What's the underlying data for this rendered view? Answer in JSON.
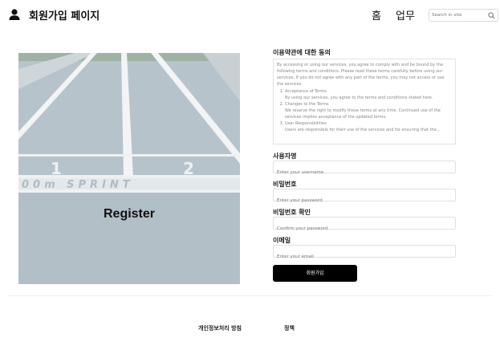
{
  "header": {
    "site_title": "회원가입 페이지",
    "nav": [
      {
        "label": "홈"
      },
      {
        "label": "업무"
      }
    ],
    "search": {
      "placeholder": "Search in site",
      "value": ""
    }
  },
  "hero": {
    "label": "Register",
    "track_text": "00m SPRINT",
    "lane_numbers": [
      "1",
      "2"
    ]
  },
  "form": {
    "terms": {
      "label": "이용약관에 대한 동의",
      "intro": "By accessing or using our services, you agree to comply with and be bound by the following terms and conditions. Please read these terms carefully before using our services. If you do not agree with any part of the terms, you may not access or use the services.",
      "items": [
        {
          "title": "Acceptance of Terms",
          "text": "By using our services, you agree to the terms and conditions stated here."
        },
        {
          "title": "Changes to the Terms",
          "text": "We reserve the right to modify these terms at any time. Continued use of the services implies acceptance of the updated terms."
        },
        {
          "title": "User Responsibilities",
          "text": "Users are responsible for their use of the services and for ensuring that the..."
        }
      ]
    },
    "username": {
      "label": "사용자명",
      "placeholder": "Enter your username",
      "value": ""
    },
    "password": {
      "label": "비밀번호",
      "placeholder": "Enter your password",
      "value": ""
    },
    "confirm": {
      "label": "비밀번호 확인",
      "placeholder": "Confirm your password",
      "value": ""
    },
    "email": {
      "label": "이메일",
      "placeholder": "Enter your email",
      "value": ""
    },
    "submit_label": "회원가입"
  },
  "footer": {
    "links": [
      {
        "label": "개인정보처리 방침"
      },
      {
        "label": "정책"
      }
    ]
  },
  "colors": {
    "primary_button": "#000000",
    "track": "#b8c4cc"
  }
}
